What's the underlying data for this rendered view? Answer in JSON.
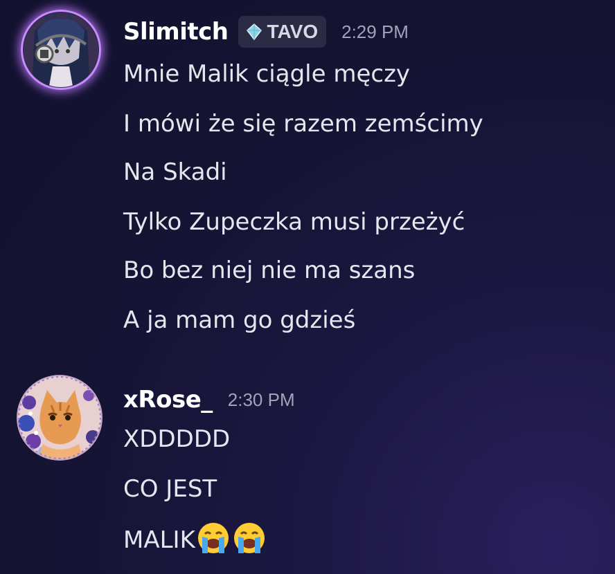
{
  "messages": [
    {
      "author": "Slimitch",
      "tag": {
        "label": "TAVO",
        "icon": "diamond-icon"
      },
      "time": "2:29 PM",
      "lines": [
        "Mnie Malik ciągle męczy",
        "I mówi że się razem zemścimy",
        "Na Skadi",
        "Tylko Zupeczka musi przeżyć",
        "Bo bez niej nie ma szans",
        "A ja mam go gdzieś"
      ]
    },
    {
      "author": "xRose_",
      "time": "2:30 PM",
      "lines": [
        "XDDDDD",
        "CO JEST",
        "MALIK"
      ],
      "emoji": [
        "loudly-crying-face",
        "loudly-crying-face"
      ]
    }
  ],
  "colors": {
    "background": "#141331",
    "text": "#e6e6ef",
    "username": "#ffffff",
    "timestamp": "#a3a3b8",
    "tag_bg": "#2b2b45",
    "avatar_glow": "#c98cff"
  }
}
